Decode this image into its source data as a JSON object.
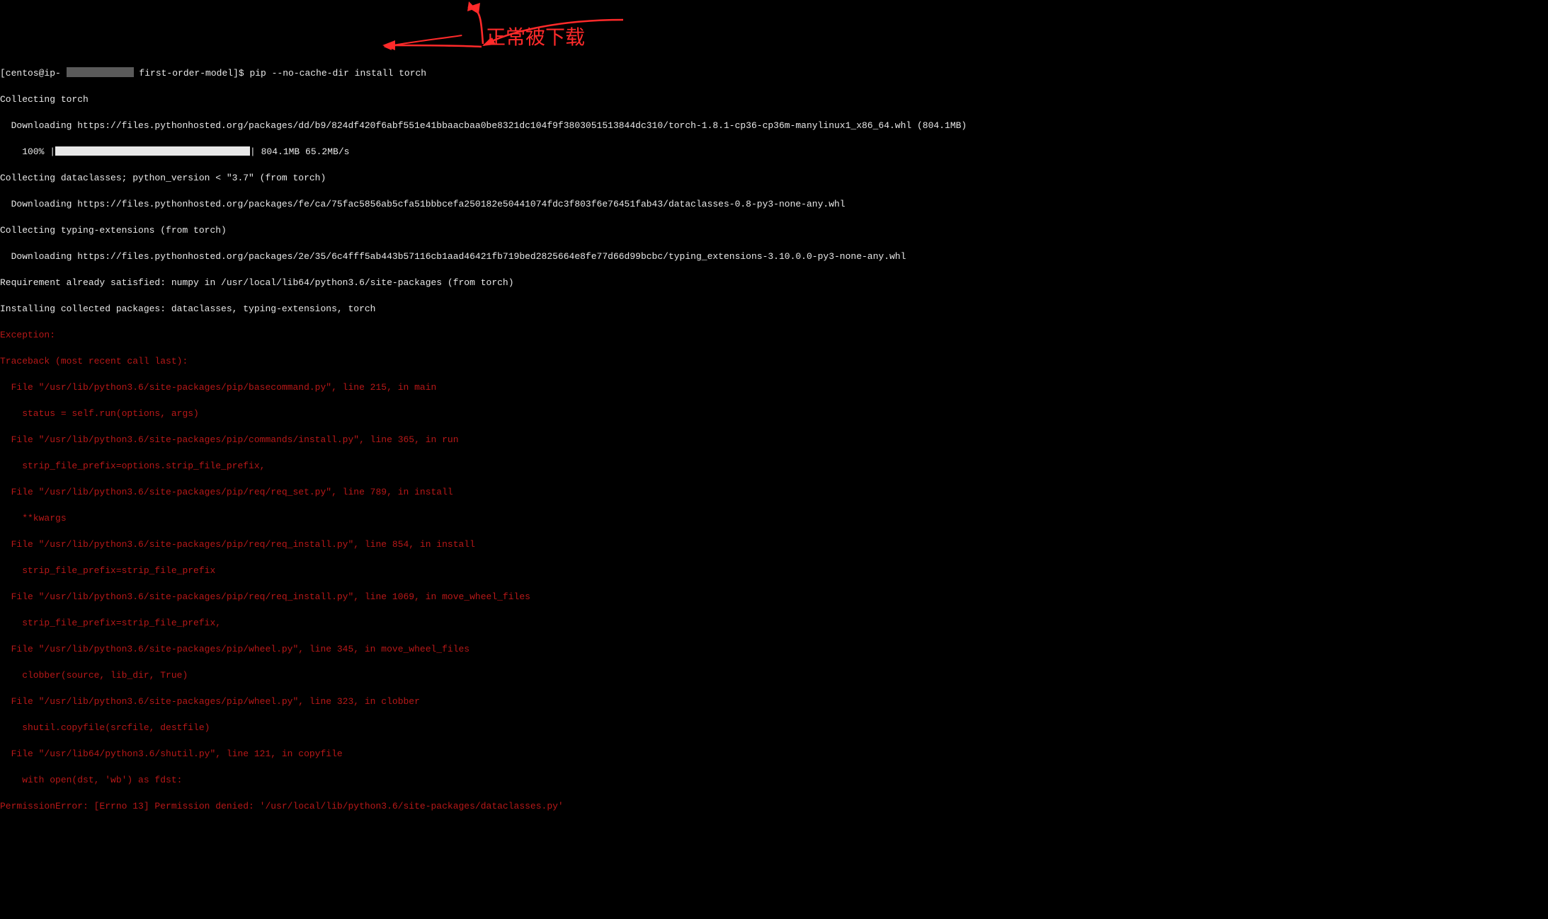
{
  "prompt": {
    "user_host": "[centos@ip- ",
    "cwd": " first-order-model]$ ",
    "command": "pip --no-cache-dir install torch"
  },
  "out": {
    "l1": "Collecting torch",
    "l2": "  Downloading https://files.pythonhosted.org/packages/dd/b9/824df420f6abf551e41bbaacbaa0be8321dc104f9f3803051513844dc310/torch-1.8.1-cp36-cp36m-manylinux1_x86_64.whl (804.1MB)",
    "l3a": "    100% |",
    "l3b": "| 804.1MB 65.2MB/s ",
    "l4": "Collecting dataclasses; python_version < \"3.7\" (from torch)",
    "l5": "  Downloading https://files.pythonhosted.org/packages/fe/ca/75fac5856ab5cfa51bbbcefa250182e50441074fdc3f803f6e76451fab43/dataclasses-0.8-py3-none-any.whl",
    "l6": "Collecting typing-extensions (from torch)",
    "l7": "  Downloading https://files.pythonhosted.org/packages/2e/35/6c4fff5ab443b57116cb1aad46421fb719bed2825664e8fe77d66d99bcbc/typing_extensions-3.10.0.0-py3-none-any.whl",
    "l8": "Requirement already satisfied: numpy in /usr/local/lib64/python3.6/site-packages (from torch)",
    "l9": "Installing collected packages: dataclasses, typing-extensions, torch"
  },
  "err": {
    "e1": "Exception:",
    "e2": "Traceback (most recent call last):",
    "e3": "  File \"/usr/lib/python3.6/site-packages/pip/basecommand.py\", line 215, in main",
    "e4": "    status = self.run(options, args)",
    "e5": "  File \"/usr/lib/python3.6/site-packages/pip/commands/install.py\", line 365, in run",
    "e6": "    strip_file_prefix=options.strip_file_prefix,",
    "e7": "  File \"/usr/lib/python3.6/site-packages/pip/req/req_set.py\", line 789, in install",
    "e8": "    **kwargs",
    "e9": "  File \"/usr/lib/python3.6/site-packages/pip/req/req_install.py\", line 854, in install",
    "e10": "    strip_file_prefix=strip_file_prefix",
    "e11": "  File \"/usr/lib/python3.6/site-packages/pip/req/req_install.py\", line 1069, in move_wheel_files",
    "e12": "    strip_file_prefix=strip_file_prefix,",
    "e13": "  File \"/usr/lib/python3.6/site-packages/pip/wheel.py\", line 345, in move_wheel_files",
    "e14": "    clobber(source, lib_dir, True)",
    "e15": "  File \"/usr/lib/python3.6/site-packages/pip/wheel.py\", line 323, in clobber",
    "e16": "    shutil.copyfile(srcfile, destfile)",
    "e17": "  File \"/usr/lib64/python3.6/shutil.py\", line 121, in copyfile",
    "e18": "    with open(dst, 'wb') as fdst:",
    "e19": "PermissionError: [Errno 13] Permission denied: '/usr/local/lib/python3.6/site-packages/dataclasses.py'"
  },
  "annotation": {
    "text": "正常被下载"
  }
}
